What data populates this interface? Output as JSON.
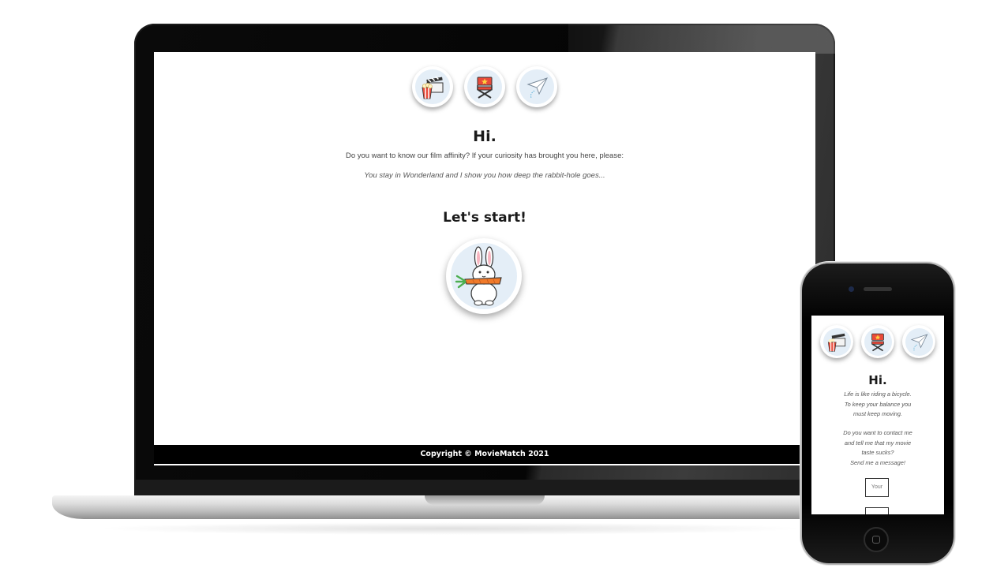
{
  "laptop_page": {
    "nav_icons": [
      "clapperboard-popcorn-icon",
      "director-chair-icon",
      "paper-plane-icon"
    ],
    "heading": "Hi.",
    "intro": "Do you want to know our film affinity? If your curiosity has brought you here, please:",
    "quote": "You stay in Wonderland and I show you how deep the rabbit-hole goes...",
    "start_heading": "Let's start!",
    "start_icon": "rabbit-with-carrot-icon",
    "footer": "Copyright © MovieMatch 2021"
  },
  "phone_page": {
    "nav_icons": [
      "clapperboard-popcorn-icon",
      "director-chair-icon",
      "paper-plane-icon"
    ],
    "heading": "Hi.",
    "text1_line1": "Life is like riding a bicycle.",
    "text1_line2": "To keep your balance you",
    "text1_line3": "must keep moving.",
    "text2_line1": "Do you want to contact me",
    "text2_line2": "and tell me that my movie",
    "text2_line3": "taste sucks?",
    "text2_line4": "Send me a message!",
    "field_placeholder": "Your"
  },
  "colors": {
    "icon_background": "#e4eef7",
    "footer_background": "#000000",
    "carrot": "#f07a2a",
    "chair": "#e84a3a"
  }
}
